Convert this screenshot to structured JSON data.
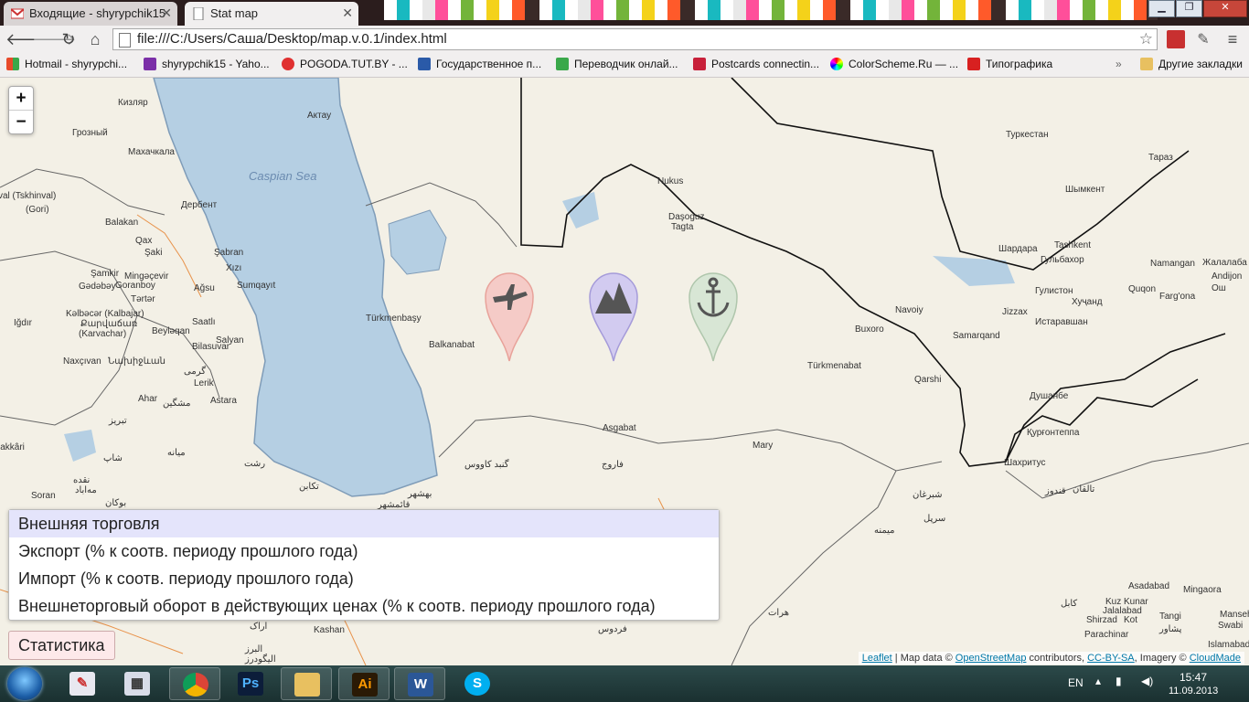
{
  "browser": {
    "tabs": [
      {
        "title": "Входящие - shyrypchik15",
        "active": false
      },
      {
        "title": "Stat map",
        "active": true
      }
    ],
    "url": "file:///C:/Users/Саша/Desktop/map.v.0.1/index.html",
    "bookmarks": [
      {
        "label": "Hotmail - shyrypchi...",
        "color": "#e84a2a"
      },
      {
        "label": "shyrypchik15 - Yaho...",
        "color": "#7b2fa8"
      },
      {
        "label": "POGODA.TUT.BY - ...",
        "color": "#e03030"
      },
      {
        "label": "Государственное п...",
        "color": "#2a5aa8"
      },
      {
        "label": "Переводчик онлай...",
        "color": "#3aa84a"
      },
      {
        "label": "Postcards connectin...",
        "color": "#c8203a"
      },
      {
        "label": "ColorScheme.Ru — ...",
        "color": "#d04ad0"
      },
      {
        "label": "Типографика",
        "color": "#d82020"
      }
    ],
    "other_bookmarks": "Другие закладки",
    "overflow": "»"
  },
  "map": {
    "sea_label": "Caspian Sea",
    "cities": [
      {
        "name": "Кизляр"
      },
      {
        "name": "Актау"
      },
      {
        "name": "Грозный"
      },
      {
        "name": "Махачкала"
      },
      {
        "name": "val (Tskhinval)"
      },
      {
        "name": "(Gori)"
      },
      {
        "name": "Дербент"
      },
      {
        "name": "Balakan"
      },
      {
        "name": "Qax"
      },
      {
        "name": "Şaki"
      },
      {
        "name": "Şabran"
      },
      {
        "name": "Xızı"
      },
      {
        "name": "Şamkir"
      },
      {
        "name": "Mingəçevir"
      },
      {
        "name": "Sumqayıt"
      },
      {
        "name": "Gədəbəy"
      },
      {
        "name": "Goranboy"
      },
      {
        "name": "Ağsu"
      },
      {
        "name": "Tərtər"
      },
      {
        "name": "Kəlbəcər (Kalbajar)"
      },
      {
        "name": "Քարվաճառ"
      },
      {
        "name": "(Karvachar)"
      },
      {
        "name": "Beyləqan"
      },
      {
        "name": "Saatlı"
      },
      {
        "name": "Salyan"
      },
      {
        "name": "Bilasuvar"
      },
      {
        "name": "Iğdır"
      },
      {
        "name": "Naxçıvan"
      },
      {
        "name": "Նախիջևան"
      },
      {
        "name": "گرمی"
      },
      {
        "name": "Lerik"
      },
      {
        "name": "Ahar"
      },
      {
        "name": "مشگین"
      },
      {
        "name": "Astara"
      },
      {
        "name": "تبریز"
      },
      {
        "name": "lakkâri"
      },
      {
        "name": "میانه"
      },
      {
        "name": "شاپ"
      },
      {
        "name": "رشت"
      },
      {
        "name": "نقده"
      },
      {
        "name": "مه‌اباد"
      },
      {
        "name": "Soran"
      },
      {
        "name": "بوکان"
      },
      {
        "name": "تکابن"
      },
      {
        "name": "Türkmenbaşy"
      },
      {
        "name": "Balkanabat"
      },
      {
        "name": "Nukus"
      },
      {
        "name": "Daşoguz"
      },
      {
        "name": "Tagta"
      },
      {
        "name": "Туркестан"
      },
      {
        "name": "Тараз"
      },
      {
        "name": "Шымкент"
      },
      {
        "name": "Шардара"
      },
      {
        "name": "Tashkent"
      },
      {
        "name": "Гульбахор"
      },
      {
        "name": "Гулистон"
      },
      {
        "name": "Andijon"
      },
      {
        "name": "Жалалаба"
      },
      {
        "name": "Namangan"
      },
      {
        "name": "Navoiy"
      },
      {
        "name": "Jizzax"
      },
      {
        "name": "Хуҷанд"
      },
      {
        "name": "Quqon"
      },
      {
        "name": "Farg'ona"
      },
      {
        "name": "Ош"
      },
      {
        "name": "Buxoro"
      },
      {
        "name": "Samarqand"
      },
      {
        "name": "Истаравшан"
      },
      {
        "name": "Türkmenabat"
      },
      {
        "name": "Qarshi"
      },
      {
        "name": "Душанбе"
      },
      {
        "name": "Asgabat"
      },
      {
        "name": "Mary"
      },
      {
        "name": "Қурғонтеппа"
      },
      {
        "name": "Шахритус"
      },
      {
        "name": "گنبد کاووس"
      },
      {
        "name": "فاروج"
      },
      {
        "name": "بهشهر"
      },
      {
        "name": "قائمشهر"
      },
      {
        "name": "شبرغان"
      },
      {
        "name": "تالقان"
      },
      {
        "name": "قندوز"
      },
      {
        "name": "سرپل"
      },
      {
        "name": "میمنه"
      },
      {
        "name": "Asadabad"
      },
      {
        "name": "Mingaora"
      },
      {
        "name": "Kuz Kunar"
      },
      {
        "name": "Jalalabad"
      },
      {
        "name": "Kot"
      },
      {
        "name": "کابل"
      },
      {
        "name": "Shirzad"
      },
      {
        "name": "Tangi"
      },
      {
        "name": "Mansehra"
      },
      {
        "name": "Swabi"
      },
      {
        "name": "Parachinar"
      },
      {
        "name": "پشاور"
      },
      {
        "name": "Islamabad"
      },
      {
        "name": "هرات"
      },
      {
        "name": "Kashan"
      },
      {
        "name": "فردوس"
      },
      {
        "name": "اراک"
      },
      {
        "name": "البرز"
      },
      {
        "name": "الیگودرز"
      }
    ],
    "markers": [
      {
        "name": "airplane-marker",
        "color": "#f08a8a"
      },
      {
        "name": "mountain-marker",
        "color": "#9a8ae8"
      },
      {
        "name": "anchor-marker",
        "color": "#a8c8a8"
      }
    ],
    "zoom_in": "+",
    "zoom_out": "−",
    "menu": {
      "header": "Внешняя торговля",
      "items": [
        "Экспорт (% к соотв. периоду прошлого года)",
        "Импорт (% к соотв. периоду прошлого года)",
        "Внешнеторговый оборот в действующих ценах (% к соотв. периоду прошлого года)"
      ]
    },
    "stat_button": "Статистика",
    "attribution": {
      "leaflet": "Leaflet",
      "map_data": " | Map data © ",
      "osm": "OpenStreetMap",
      "contributors": " contributors, ",
      "license": "CC-BY-SA",
      "imagery": ", Imagery © ",
      "cloudmade": "CloudMade"
    }
  },
  "taskbar": {
    "language": "EN",
    "time": "15:47",
    "date": "11.09.2013",
    "apps": [
      "paint",
      "calculator",
      "chrome",
      "photoshop",
      "explorer",
      "illustrator",
      "word",
      "skype"
    ]
  }
}
